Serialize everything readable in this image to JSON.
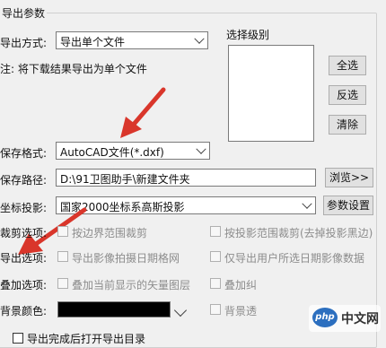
{
  "group": {
    "title": "导出参数"
  },
  "export_mode": {
    "label": "导出方式:",
    "value": "导出单个文件"
  },
  "note": "注: 将下载结果导出为单个文件",
  "level_select": {
    "title": "选择级别",
    "select_all": "全选",
    "invert": "反选",
    "clear": "清除"
  },
  "save_format": {
    "label": "保存格式:",
    "value": "AutoCAD文件(*.dxf)"
  },
  "save_path": {
    "label": "保存路径:",
    "value": "D:\\91卫图助手\\新建文件夹",
    "browse": "浏览>>"
  },
  "projection": {
    "label": "坐标投影:",
    "value": "国家2000坐标系高斯投影",
    "settings": "参数设置"
  },
  "crop": {
    "label": "裁剪选项:",
    "opt1": "按边界范围裁剪",
    "opt2": "按投影范围裁剪(去掉投影黑边)"
  },
  "export_opts": {
    "label": "导出选项:",
    "opt1": "导出影像拍摄日期格网",
    "opt2": "仅导出用户所选日期影像数据"
  },
  "overlay": {
    "label": "叠加选项:",
    "opt1": "叠加当前显示的矢量图层",
    "opt2": "叠加纠"
  },
  "bg_color": {
    "label": "背景颜色:",
    "color": "#000000",
    "opt2": "背景透"
  },
  "open_dir": {
    "label": "导出完成后打开导出目录"
  },
  "watermark": {
    "logo": "php",
    "text": "中文网"
  },
  "colors": {
    "arrow": "#d9362b",
    "combo_border": "#7a7a7a"
  }
}
